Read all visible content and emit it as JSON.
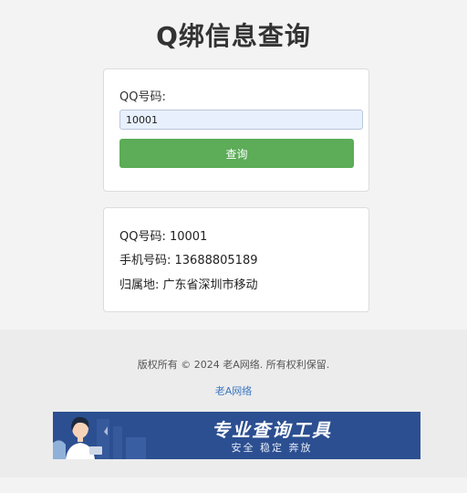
{
  "header": {
    "title": "Q绑信息查询"
  },
  "query_form": {
    "label": "QQ号码:",
    "input_value": "10001",
    "button_label": "查询"
  },
  "result": {
    "qq_line": "QQ号码: 10001",
    "phone_line": "手机号码: 13688805189",
    "location_line": "归属地: 广东省深圳市移动"
  },
  "footer": {
    "copyright": "版权所有 © 2024 老A网络. 所有权利保留.",
    "link_text": "老A网络"
  },
  "banner": {
    "headline": "专业查询工具",
    "subtitle": "安全 稳定 奔放"
  },
  "colors": {
    "button": "#5cac58",
    "input_bg": "#e8f0fe",
    "link": "#3b77c2",
    "banner_bg": "#2c4f91"
  }
}
